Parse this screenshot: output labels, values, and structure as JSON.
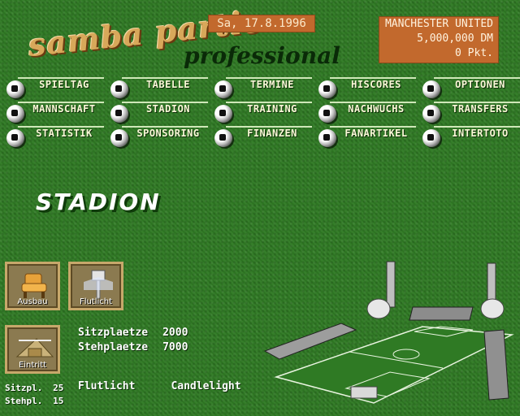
{
  "header": {
    "logo_main": "samba partie",
    "logo_sub": "professional",
    "date": "Sa, 17.8.1996",
    "team": "MANCHESTER UNITED",
    "money": "5,000,000 DM",
    "points": "0 Pkt."
  },
  "menu": {
    "row1": [
      "SPIELTAG",
      "TABELLE",
      "TERMINE",
      "HISCORES",
      "OPTIONEN"
    ],
    "row2": [
      "MANNSCHAFT",
      "STADION",
      "TRAINING",
      "NACHWUCHS",
      "TRANSFERS"
    ],
    "row3": [
      "STATISTIK",
      "SPONSORING",
      "FINANZEN",
      "FANARTIKEL",
      "INTERTOTO"
    ]
  },
  "page_title": "STADION",
  "buttons": {
    "ausbau": "Ausbau",
    "flutlicht": "Flutlicht",
    "eintritt": "Eintritt"
  },
  "stats": {
    "sitzplaetze_label": "Sitzplaetze",
    "sitzplaetze_value": "2000",
    "stehplaetze_label": "Stehplaetze",
    "stehplaetze_value": "7000",
    "flutlicht_label": "Flutlicht",
    "flutlicht_value": "Candlelight"
  },
  "prices": {
    "sitz_label": "Sitzpl.",
    "sitz_value": "25",
    "steh_label": "Stehpl.",
    "steh_value": "15"
  },
  "colors": {
    "grass": "#2f7a24",
    "panel": "#c2692d",
    "menu_text": "#fbf8d8"
  }
}
